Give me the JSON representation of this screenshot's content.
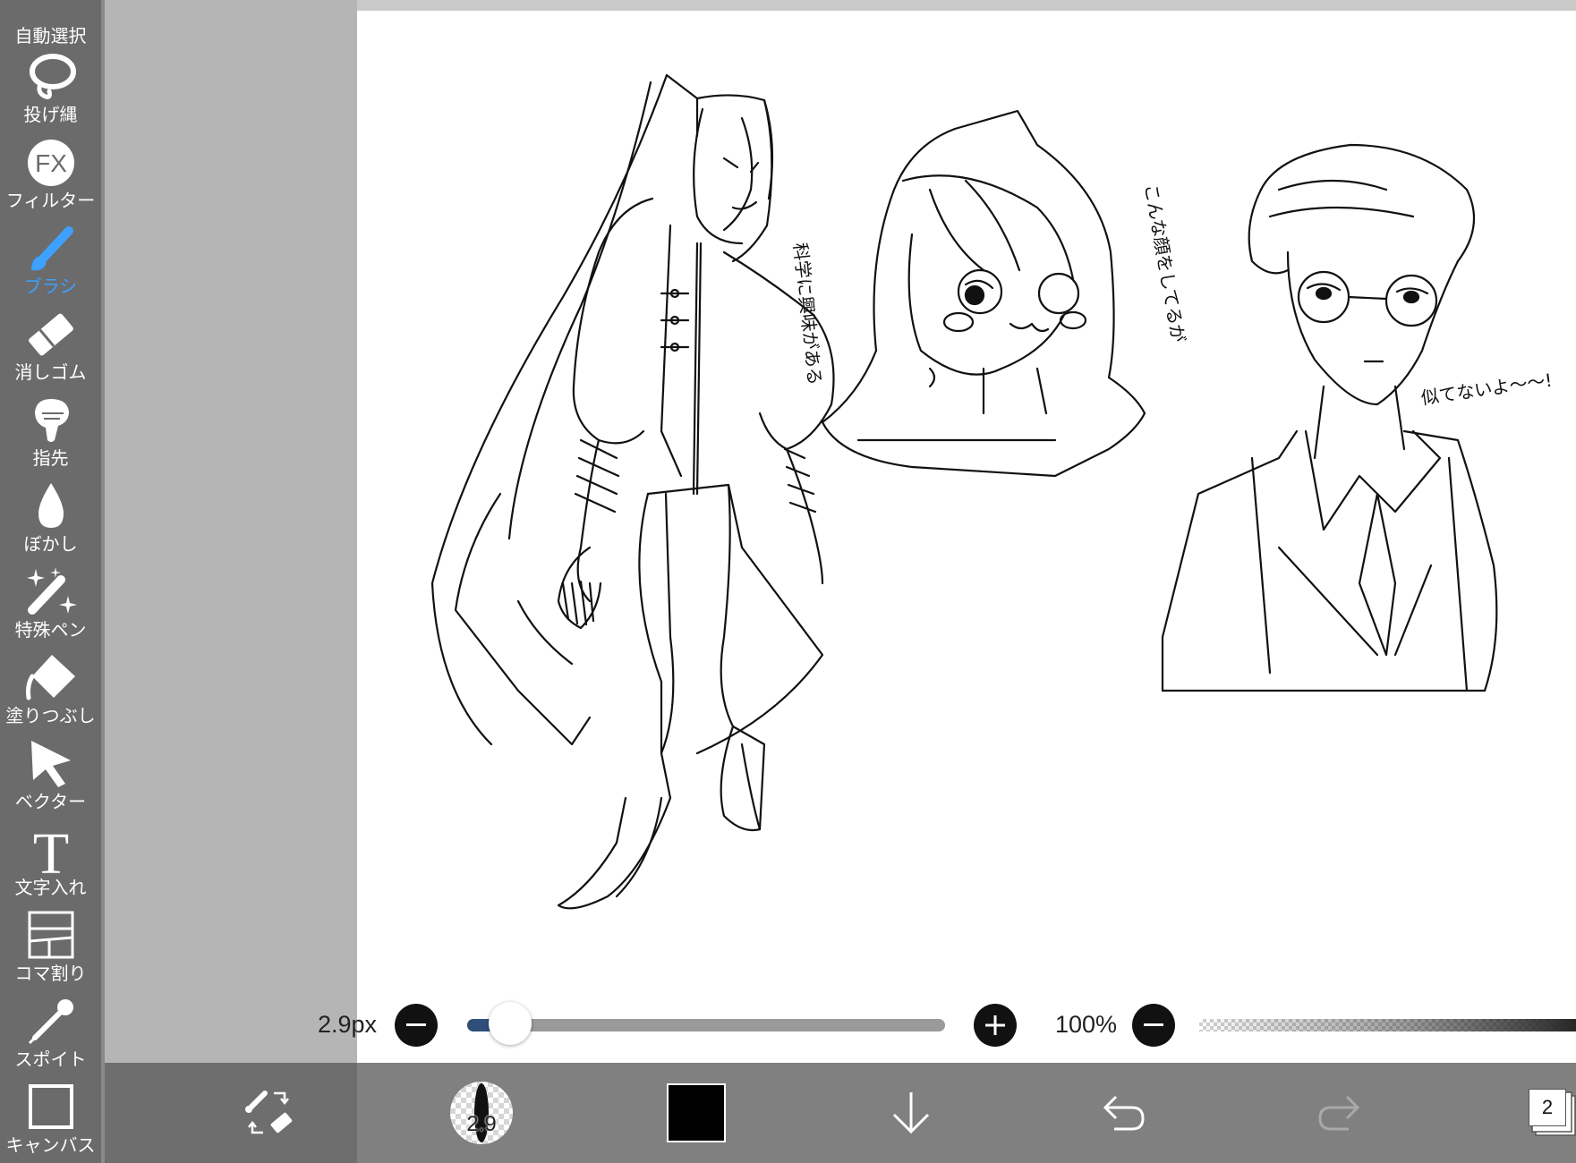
{
  "sidebar": {
    "tools": [
      {
        "id": "auto-select",
        "label": "自動選択",
        "icon": "magic-wand-icon"
      },
      {
        "id": "lasso",
        "label": "投げ縄",
        "icon": "lasso-icon"
      },
      {
        "id": "filter",
        "label": "フィルター",
        "icon": "fx-icon",
        "icon_text": "FX"
      },
      {
        "id": "brush",
        "label": "ブラシ",
        "icon": "brush-icon",
        "active": true
      },
      {
        "id": "eraser",
        "label": "消しゴム",
        "icon": "eraser-icon"
      },
      {
        "id": "smudge",
        "label": "指先",
        "icon": "finger-icon"
      },
      {
        "id": "blur",
        "label": "ぼかし",
        "icon": "drop-icon"
      },
      {
        "id": "special-pen",
        "label": "特殊ペン",
        "icon": "sparkle-pen-icon"
      },
      {
        "id": "fill",
        "label": "塗りつぶし",
        "icon": "bucket-icon"
      },
      {
        "id": "vector",
        "label": "ベクター",
        "icon": "arrow-cursor-icon"
      },
      {
        "id": "text",
        "label": "文字入れ",
        "icon": "text-t-icon",
        "icon_text": "T"
      },
      {
        "id": "frame",
        "label": "コマ割り",
        "icon": "panel-grid-icon"
      },
      {
        "id": "eyedropper",
        "label": "スポイト",
        "icon": "eyedropper-icon"
      },
      {
        "id": "canvas",
        "label": "キャンバス",
        "icon": "canvas-square-icon"
      }
    ],
    "active_color": "#3ea0ff"
  },
  "brush_controls": {
    "size_label": "2.9px",
    "size_fraction": 0.09,
    "opacity_label": "100%",
    "opacity_fraction": 1.0
  },
  "canvas": {
    "annotations": [
      "こんな顔をしてるが",
      "科学に興味がある",
      "似てないよ〜〜!"
    ]
  },
  "bottom_bar": {
    "brush_preview_text": "2.9",
    "current_color": "#000000",
    "layer_count": "2",
    "icons": [
      "swap-tools-icon",
      "brush-preview-icon",
      "color-swatch",
      "move-down-icon",
      "undo-icon",
      "redo-icon",
      "layers-icon"
    ]
  }
}
